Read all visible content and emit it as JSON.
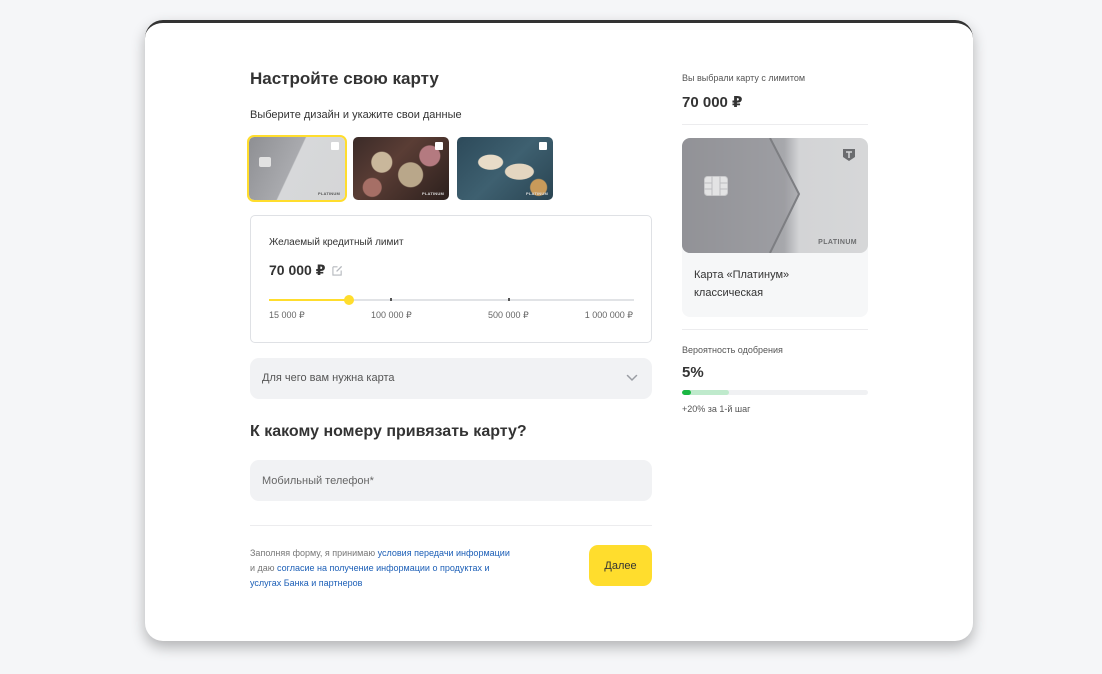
{
  "form": {
    "title": "Настройте свою карту",
    "subtitle": "Выберите дизайн и укажите свои данные",
    "designs": [
      {
        "name": "design-platinum-classic",
        "selected": true,
        "label": "PLATINUM"
      },
      {
        "name": "design-snake",
        "selected": false,
        "label": "PLATINUM"
      },
      {
        "name": "design-cranes",
        "selected": false,
        "label": "PLATINUM"
      }
    ],
    "limit": {
      "label": "Желаемый кредитный лимит",
      "value": "70 000 ₽",
      "slider_fraction": 0.22,
      "scale": [
        "15 000 ₽",
        "100 000 ₽",
        "500 000 ₽",
        "1 000 000 ₽"
      ]
    },
    "purpose_select": {
      "placeholder": "Для чего вам нужна карта"
    },
    "phone_section_title": "К какому номеру привязать карту?",
    "phone_input": {
      "placeholder": "Мобильный телефон*",
      "value": ""
    },
    "consent": {
      "text1": "Заполняя форму, я принимаю ",
      "link1": "условия передачи информации",
      "text2": " и даю ",
      "link2": "согласие на получение информации о продуктах и услугах Банка и партнеров"
    },
    "next_button": "Далее"
  },
  "summary": {
    "caption": "Вы выбрали карту с лимитом",
    "amount": "70 000 ₽",
    "card_label": "PLATINUM",
    "card_name": "Карта «Платинум» классическая",
    "approval": {
      "caption": "Вероятность одобрения",
      "value": "5%",
      "current_percent": 5,
      "next_percent": 25,
      "hint": "+20% за 1-й шаг"
    }
  },
  "colors": {
    "accent": "#ffdd2d",
    "link": "#1c5fb7",
    "success": "#1bb743"
  }
}
